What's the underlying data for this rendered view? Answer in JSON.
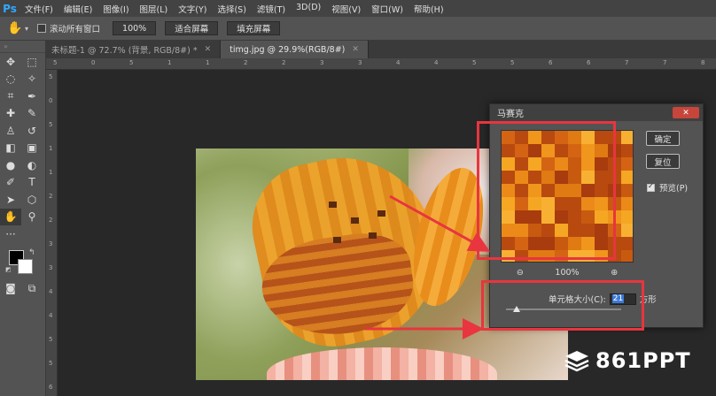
{
  "app": {
    "logo": "Ps"
  },
  "menu": [
    "文件(F)",
    "编辑(E)",
    "图像(I)",
    "图层(L)",
    "文字(Y)",
    "选择(S)",
    "滤镜(T)",
    "3D(D)",
    "视图(V)",
    "窗口(W)",
    "帮助(H)"
  ],
  "options": {
    "scroll_all_label": "滚动所有窗口",
    "zoom_value": "100%",
    "fit_screen_label": "适合屏幕",
    "fill_screen_label": "填充屏幕"
  },
  "tabs": [
    {
      "label": "未标题-1 @ 72.7% (背景, RGB/8#) *"
    },
    {
      "label": "timg.jpg @ 29.9%(RGB/8#)"
    }
  ],
  "ruler_top": [
    "5",
    "0",
    "5",
    "1",
    "1",
    "2",
    "2",
    "3",
    "3",
    "4",
    "4",
    "5",
    "5",
    "6",
    "6",
    "7",
    "7",
    "8"
  ],
  "ruler_left": [
    "5",
    "0",
    "5",
    "1",
    "1",
    "2",
    "2",
    "3",
    "3",
    "4",
    "4",
    "5",
    "5",
    "6"
  ],
  "dialog": {
    "title": "马赛克",
    "ok_label": "确定",
    "reset_label": "复位",
    "preview_label": "预览(P)",
    "zoom_level": "100%",
    "cell_size_label": "单元格大小(C):",
    "cell_size_value": "21",
    "cell_unit": "方形"
  },
  "colors": {
    "accent_red": "#e8353f",
    "ps_blue": "#31a8ff"
  },
  "watermark": {
    "text": "861PPT"
  }
}
